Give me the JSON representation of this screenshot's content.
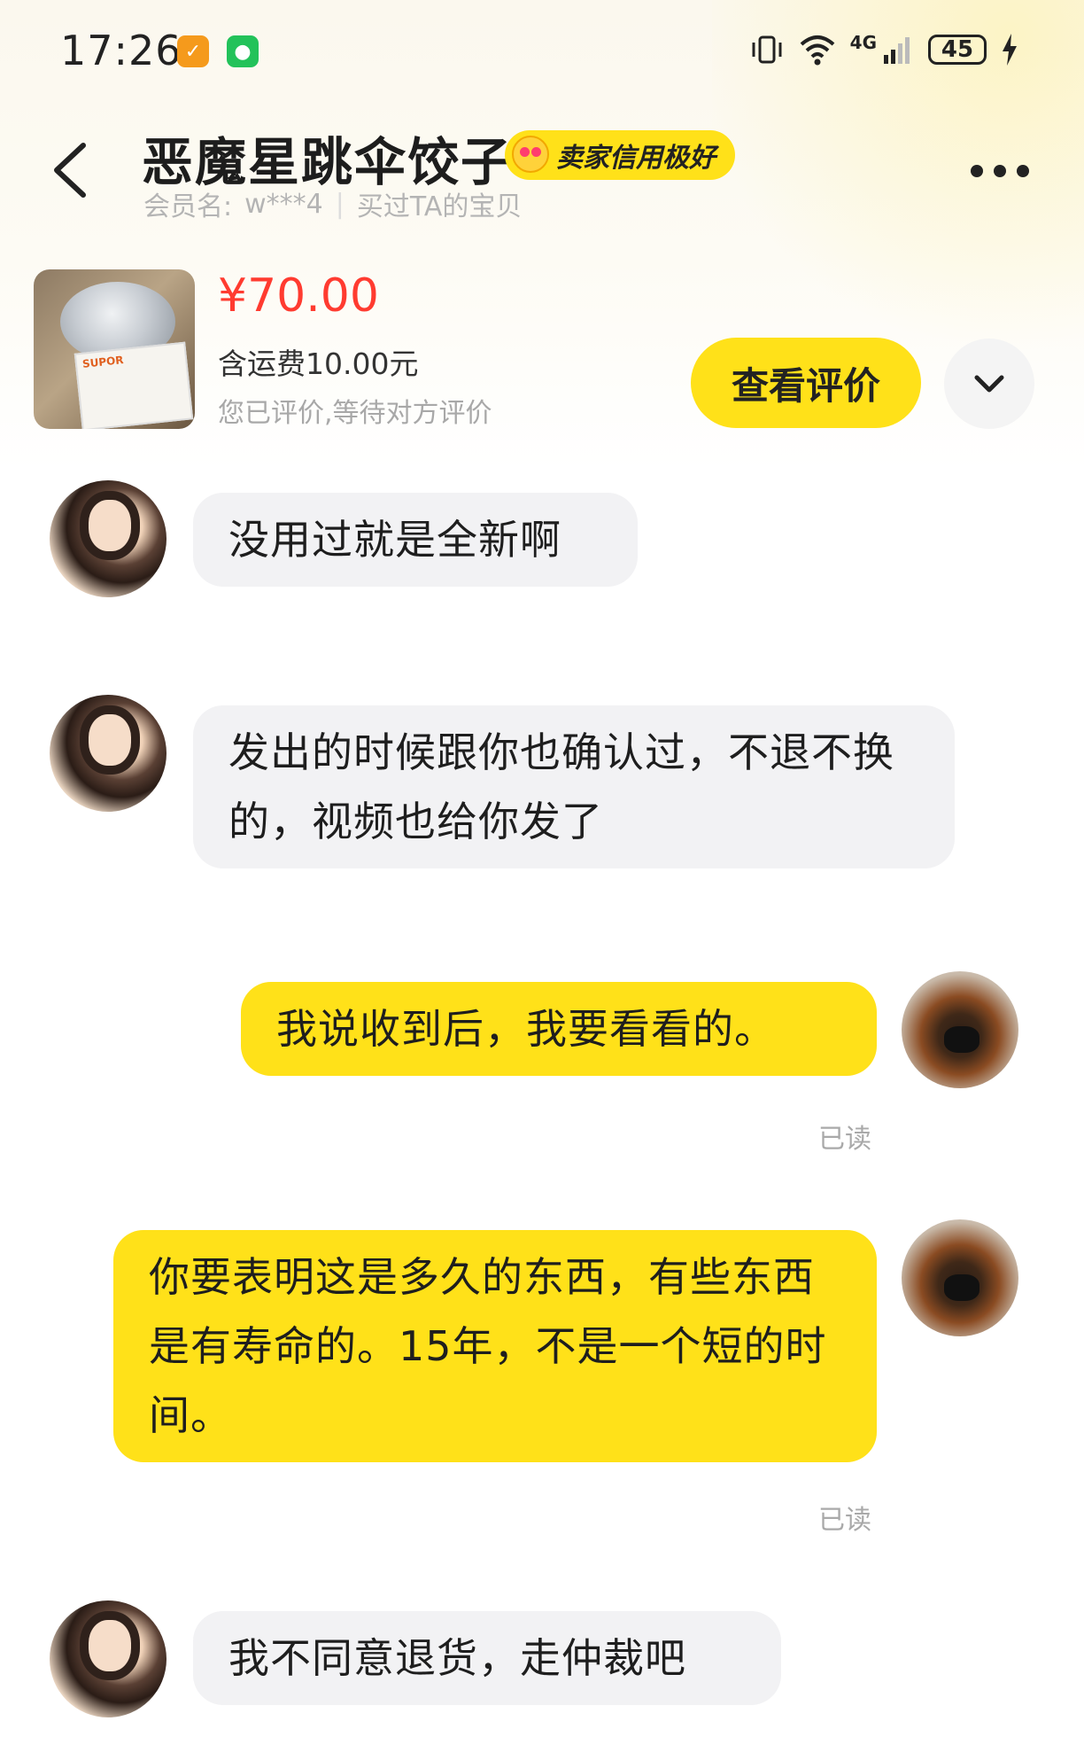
{
  "status_bar": {
    "time": "17:26",
    "network": "4G",
    "battery": "45"
  },
  "header": {
    "title": "恶魔星跳伞饺子",
    "credit_badge": "卖家信用极好",
    "member_label": "会员名:",
    "member_name": "w***4",
    "bought_text": "买过TA的宝贝"
  },
  "product": {
    "price": "¥70.00",
    "shipping": "含运费10.00元",
    "review_status": "您已评价,等待对方评价",
    "review_button": "查看评价"
  },
  "messages": [
    {
      "sender": "seller",
      "text": "没用过就是全新啊"
    },
    {
      "sender": "seller",
      "text": "发出的时候跟你也确认过，不退不换的，视频也给你发了"
    },
    {
      "sender": "me",
      "text": "我说收到后，我要看看的。",
      "status": "已读"
    },
    {
      "sender": "me",
      "text": "你要表明这是多久的东西，有些东西是有寿命的。15年，不是一个短的时间。",
      "status": "已读"
    },
    {
      "sender": "seller",
      "text": "我不同意退货，走仲裁吧"
    }
  ],
  "colors": {
    "accent_yellow": "#ffe119",
    "price_red": "#ff3b30",
    "incoming_bubble": "#f2f2f4"
  },
  "icons": [
    "back-arrow-icon",
    "more-dots-icon",
    "chevron-down-icon",
    "wifi-icon",
    "signal-icon",
    "vibrate-icon",
    "charging-icon"
  ]
}
